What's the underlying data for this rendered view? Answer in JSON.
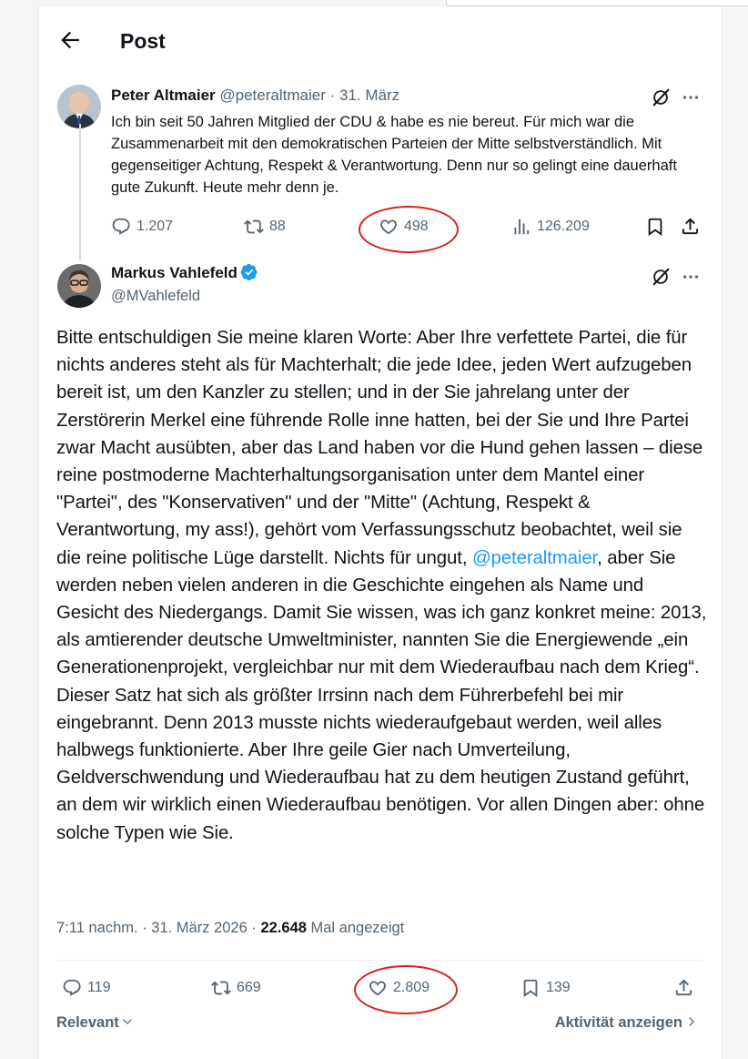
{
  "header": {
    "title": "Post"
  },
  "tweet1": {
    "name": "Peter Altmaier",
    "handle": "@peteraltmaier",
    "separator": "·",
    "date": "31. März",
    "text": "Ich bin seit 50 Jahren Mitglied der CDU & habe es nie bereut.  Für mich war die Zusammenarbeit mit den demokratischen Parteien der Mitte selbstverständlich. Mit gegenseitiger Achtung, Respekt & Verantwortung. Denn nur so gelingt eine dauerhaft gute Zukunft. Heute mehr denn je.",
    "replies": "1.207",
    "reposts": "88",
    "likes": "498",
    "views": "126.209"
  },
  "tweet2": {
    "name": "Markus Vahlefeld",
    "handle": "@MVahlefeld",
    "text_before": "Bitte entschuldigen Sie meine klaren Worte: Aber Ihre verfettete Partei, die für nichts anderes steht als für Machterhalt; die jede Idee, jeden Wert aufzugeben bereit ist, um den Kanzler zu stellen; und in der Sie jahrelang unter der Zerstörerin Merkel eine führende Rolle inne hatten, bei der Sie und Ihre Partei zwar Macht ausübten, aber das Land haben vor die Hund gehen lassen – diese reine postmoderne Machterhaltungsorganisation unter dem Mantel einer \"Partei\", des \"Konservativen\" und der \"Mitte\" (Achtung, Respekt & Verantwortung, my ass!), gehört vom Verfassungsschutz beobachtet, weil sie die reine politische Lüge darstellt. Nichts für ungut, ",
    "mention": "@peteraltmaier",
    "text_after": ", aber Sie werden neben vielen anderen in die Geschichte eingehen als Name und Gesicht des Niedergangs. Damit Sie wissen, was ich ganz konkret meine: 2013, als amtierender deutsche Umweltminister, nannten Sie die Energiewende „ein Generationenprojekt, vergleichbar nur mit dem Wiederaufbau nach dem Krieg“.  Dieser Satz hat sich als größter Irrsinn nach dem Führerbefehl bei mir eingebrannt. Denn 2013 musste nichts wiederaufgebaut werden, weil alles halbwegs funktionierte. Aber Ihre geile Gier nach Umverteilung, Geldverschwendung und Wiederaufbau hat zu dem heutigen Zustand geführt, an dem wir wirklich einen Wiederaufbau benötigen. Vor allen Dingen aber: ohne solche Typen wie Sie.",
    "time": "7:11 nachm.",
    "separator": "·",
    "date": "31. März 2026",
    "views_sep": "·",
    "views": "22.648",
    "views_label": "Mal angezeigt",
    "replies": "119",
    "reposts": "669",
    "likes": "2.809",
    "bookmarks": "139"
  },
  "footer": {
    "sort_label": "Relevant",
    "activity_label": "Aktivität anzeigen"
  },
  "colors": {
    "accent": "#1d9bf0",
    "annotation": "#d8231f",
    "muted": "#536471"
  }
}
